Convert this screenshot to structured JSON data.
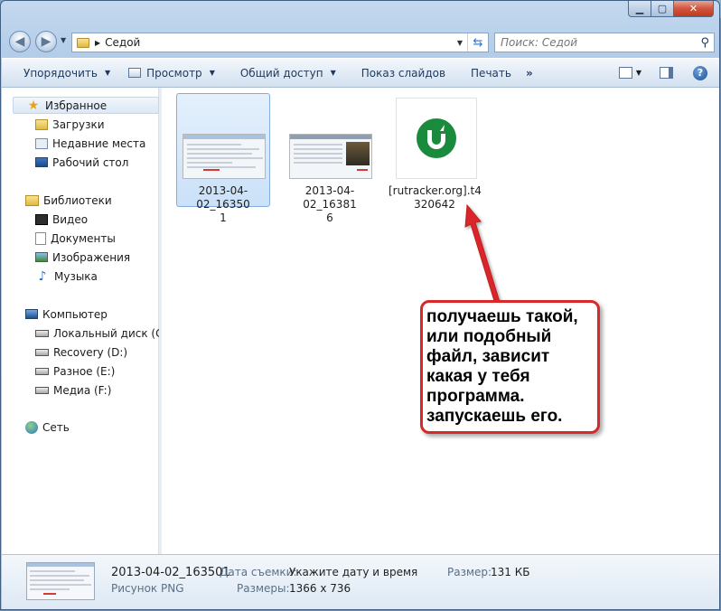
{
  "address": {
    "path": "Седой"
  },
  "search": {
    "placeholder": "Поиск: Седой"
  },
  "toolbar": {
    "organize": "Упорядочить",
    "view": "Просмотр",
    "share": "Общий доступ",
    "slideshow": "Показ слайдов",
    "print": "Печать",
    "more": "»"
  },
  "nav": {
    "favorites": "Избранное",
    "downloads": "Загрузки",
    "recent": "Недавние места",
    "desktop": "Рабочий стол",
    "libraries": "Библиотеки",
    "video": "Видео",
    "documents": "Документы",
    "pictures": "Изображения",
    "music": "Музыка",
    "computer": "Компьютер",
    "drive_c": "Локальный диск (C:)",
    "drive_d": "Recovery (D:)",
    "drive_e": "Разное (E:)",
    "drive_f": "Медиа (F:)",
    "network": "Сеть"
  },
  "files": [
    {
      "name_line1": "2013-04-02_16350",
      "name_line2": "1",
      "selected": true
    },
    {
      "name_line1": "2013-04-02_16381",
      "name_line2": "6",
      "selected": false
    },
    {
      "name_line1": "[rutracker.org].t4",
      "name_line2": "320642",
      "selected": false
    }
  ],
  "annotation": {
    "text": "получаешь такой,\nили подобный\nфайл, зависит\nкакая у тебя\nпрограмма.\nзапускаешь его.",
    "color": "#d8282a"
  },
  "details": {
    "filename": "2013-04-02_163501",
    "filetype": "Рисунок PNG",
    "date_label": "Дата съемки:",
    "date_value": "Укажите дату и время",
    "size_label": "Размер:",
    "size_value": "131 КБ",
    "dims_label": "Размеры:",
    "dims_value": "1366 x 736"
  },
  "colors": {
    "accent": "#3399ff",
    "utorrent": "#1a8a3c"
  }
}
